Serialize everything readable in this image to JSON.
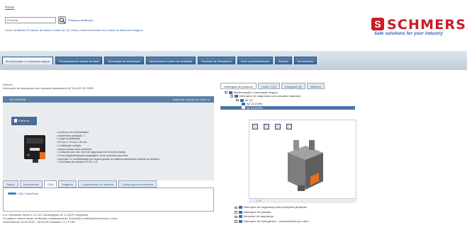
{
  "header": {
    "home_link": "Home",
    "search_value": "Procurar",
    "advanced_search": "Pesquisa detalhada",
    "quicklinks": "Home | Editorial | Proteção de dados | Índice (A–Z) | Entre | www.schmersal.com | Base de dados de imagens",
    "brand_mark": "S",
    "brand_name": "SCHMERSAL",
    "brand_slogan": "Safe solutions for your industry",
    "brand_color": "#c81d25"
  },
  "nav": {
    "tabs": [
      "Monitorização e comutação segura",
      "Processamento seguro de sinal",
      "Tecnologia de automação",
      "Interruptores e piloto de avaliação",
      "Produtos de Elevadores",
      "Novo produto/software",
      "Arquivo",
      "Documentos"
    ]
  },
  "product": {
    "breadcrumb_1": "Home ▸",
    "breadcrumb_2": "Interruptor de segurança com actuador separado ▸ AZ 15 ▸ AZ 15 ZVRK",
    "title": "AZ 15 ZVRK",
    "add_to_cart": "Adicionar produto ao cesto ☑",
    "datasheet_button": "Folha de dados",
    "features": [
      "Invólucro em termoplástico",
      "Isolamento protegido ☐",
      "Longa durabilidade",
      "52 mm x 75 mm x 30 mm",
      "Codificação múltipla",
      "amplo espaço para conexões",
      "Contactos com alto nível de segurança com tensões baixas",
      "Furos longitudinais para regulagem, furos redondos para fixar",
      "Inserção e a contaminação por sujeira graças ao sistema patenteado sistema de cilindros",
      "3 Entradas de condutor M 16 x 1,5"
    ],
    "detail_tabs": [
      "Dados",
      "Documentos",
      "CAD",
      "Imagens",
      "Componentes do sistema",
      "Código para encomenda"
    ],
    "traceparts": "CAD TraceParts",
    "legal_1": "K.A. Schmersal GmbH & Co. KG, Möddinghofe 30, D-42279 Wuppertal",
    "legal_2": "Os dados e valores foram verificados cuidadosamente. Excluindo modificações técnicas e erros.",
    "legal_3": "Generated am 16.03.2015 – 05:03:22h Kasbase 2.2.7 F DBI"
  },
  "right": {
    "tabs": [
      "Hierarquia de produtos",
      "Cesto ☐ (0)",
      "Comparar (0)",
      "Histórico"
    ],
    "tree": [
      {
        "label": "Monitorização e comutação segura",
        "level": 1,
        "selected": false
      },
      {
        "label": "Interruptor de segurança com actuador separado",
        "level": 2,
        "selected": false
      },
      {
        "label": "AZ 15",
        "level": 3,
        "selected": false
      },
      {
        "label": "AZ 15 ZVRK",
        "level": 4,
        "selected": false
      },
      {
        "label": "AZ 15 ZVRK",
        "level": 4,
        "selected": true
      }
    ],
    "viewer_footer": "▢ ⟳",
    "tree_bottom": [
      "Interruptor de segurança para proteções giratórias",
      "Interruptor de posição",
      "Sensores de segurança",
      "Interruptor de emergência – accionamento por cabo"
    ]
  }
}
